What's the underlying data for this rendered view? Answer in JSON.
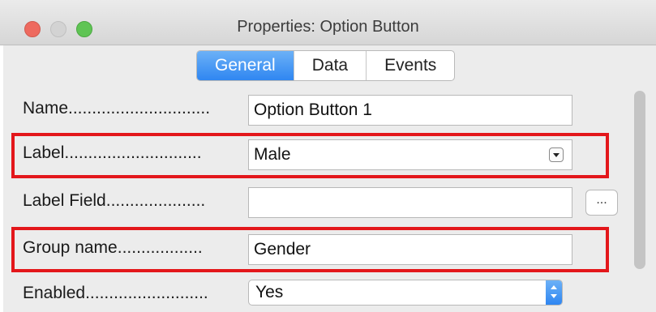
{
  "window": {
    "title": "Properties: Option Button",
    "controls": [
      "close",
      "minimize",
      "zoom"
    ]
  },
  "tabs": [
    {
      "label": "General",
      "active": true
    },
    {
      "label": "Data",
      "active": false
    },
    {
      "label": "Events",
      "active": false
    }
  ],
  "fields": {
    "name": {
      "label": "Name..............................",
      "value": "Option Button 1"
    },
    "label": {
      "label": "Label.............................",
      "value": "Male"
    },
    "label_field": {
      "label": "Label Field.....................",
      "value": "",
      "button": "..."
    },
    "group_name": {
      "label": "Group name..................",
      "value": "Gender"
    },
    "enabled": {
      "label": "Enabled..........................",
      "value": "Yes"
    }
  },
  "colors": {
    "accent": "#2f86f1",
    "highlight": "#e3171b",
    "close": "#ee6a5f",
    "zoom": "#5fc454"
  }
}
